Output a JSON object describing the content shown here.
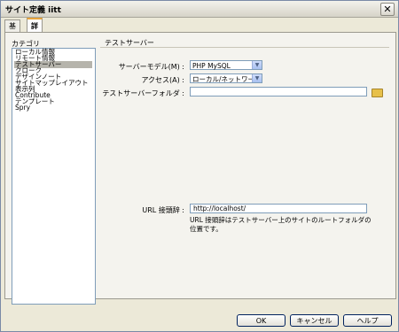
{
  "window": {
    "title": "サイト定義 iitt",
    "close_glyph": "✕"
  },
  "tabs": [
    {
      "label": "基本"
    },
    {
      "label": "詳細設定"
    }
  ],
  "category": {
    "label": "カテゴリ",
    "items": [
      "ローカル情報",
      "リモート情報",
      "テストサーバー",
      "クローク",
      "デザインノート",
      "サイトマップレイアウト",
      "表示列",
      "Contribute",
      "テンプレート",
      "Spry"
    ],
    "selected_index": 2
  },
  "section": {
    "title": "テストサーバー"
  },
  "form": {
    "server_model_label": "サーバーモデル(M) :",
    "server_model_value": "PHP MySQL",
    "access_label": "アクセス(A) :",
    "access_value": "ローカル/ネットワーク",
    "folder_label": "テストサーバーフォルダ :",
    "folder_value": "",
    "url_prefix_label": "URL 接頭辞 :",
    "url_prefix_value": "http://localhost/",
    "url_help": "URL 接頭辞はテストサーバー上のサイトのルートフォルダの位置です。"
  },
  "buttons": {
    "ok": "OK",
    "cancel": "キャンセル",
    "help": "ヘルプ"
  },
  "colors": {
    "selection": "#b6b4ac",
    "accent_tab": "#e7a33a",
    "window_bg": "#ece9d8"
  }
}
